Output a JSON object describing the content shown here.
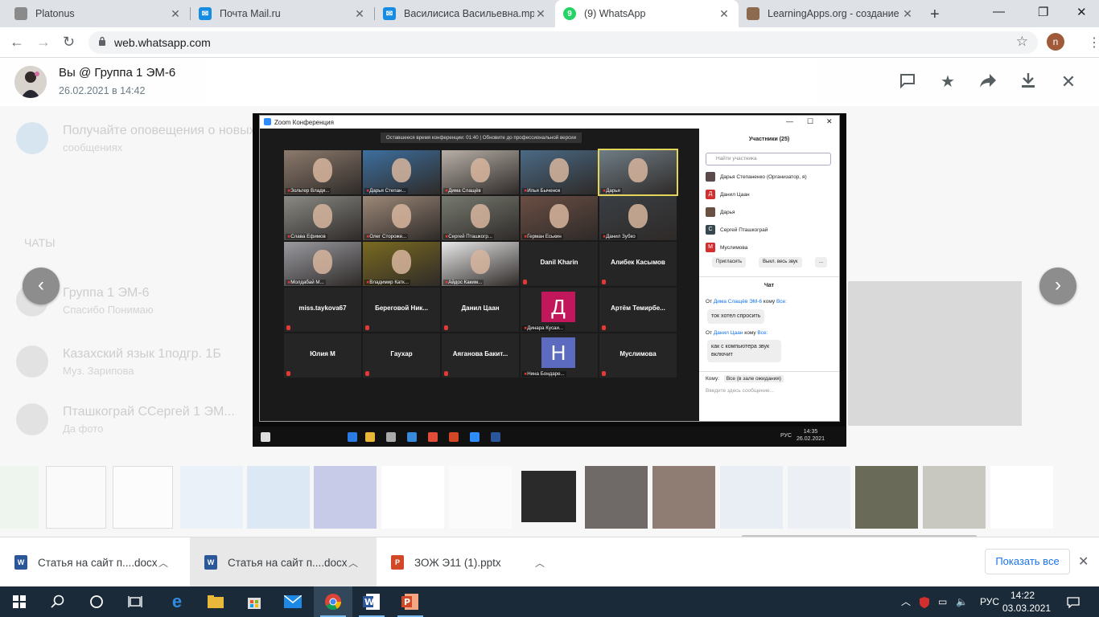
{
  "browser": {
    "tabs": [
      {
        "title": "Platonus",
        "color": "#8a8a8a"
      },
      {
        "title": "Почта Mail.ru",
        "color": "#168de2"
      },
      {
        "title": "Василисиса Васильевна.mp4",
        "color": "#168de2"
      },
      {
        "title": "(9) WhatsApp",
        "color": "#25d366",
        "badge": "9"
      },
      {
        "title": "LearningApps.org - создание",
        "color": "#8c6a4f"
      }
    ],
    "url": "web.whatsapp.com",
    "profile_initial": "n"
  },
  "viewer": {
    "sender": "Вы @ Группа 1 ЭМ-6",
    "timestamp": "26.02.2021 в 14:42",
    "bg_chats": [
      {
        "name": "Получайте оповещения о новых",
        "sub": "сообщениях"
      },
      {
        "name": "Группа 1 ЭМ-6",
        "sub": "Спасибо Понимаю"
      },
      {
        "name": "Казахский язык 1подгр. 1Б",
        "sub": "Муз. Зарипова"
      },
      {
        "name": "Пташкограй ССергей 1 ЭМ...",
        "sub": "Да фото"
      }
    ],
    "bg_label": "ЧАТЫ"
  },
  "zoom": {
    "window_title": "Zoom Конференция",
    "banner": "Оставшееся время конференции: 01:40 | Обновите до профессиональной версии",
    "tiles": [
      {
        "label": "Зольтер Влади...",
        "big": "",
        "color": "#8c7a6c"
      },
      {
        "label": "Дарья Степан...",
        "big": "",
        "color": "#3d6f9e"
      },
      {
        "label": "Дима Слащёв",
        "big": "",
        "color": "#b8b0a8"
      },
      {
        "label": "Илья Быченок",
        "big": "",
        "color": "#4a6a86"
      },
      {
        "label": "Дарья",
        "big": "",
        "color": "#6f7d86"
      },
      {
        "label": "Слава Ефимов",
        "big": "",
        "color": "#8a8a84"
      },
      {
        "label": "Олег Стороже...",
        "big": "",
        "color": "#9c8878"
      },
      {
        "label": "Сергей Пташкогр...",
        "big": "",
        "color": "#777a70"
      },
      {
        "label": "Герман Еськин",
        "big": "",
        "color": "#6a4e44"
      },
      {
        "label": "Данил Зубко",
        "big": "",
        "color": "#3a3f44"
      },
      {
        "label": "Молдабай М...",
        "big": "",
        "color": "#9a9aa0"
      },
      {
        "label": "Владимир Катк...",
        "big": "",
        "color": "#7a6a20"
      },
      {
        "label": "Айдос Каким...",
        "big": "",
        "color": "#e8e8e8"
      },
      {
        "label": "",
        "big": "Danil Kharin",
        "color": ""
      },
      {
        "label": "",
        "big": "Алибек Касымов",
        "color": ""
      },
      {
        "label": "",
        "big": "miss.taykova67",
        "color": ""
      },
      {
        "label": "",
        "big": "Береговой Ник...",
        "color": ""
      },
      {
        "label": "",
        "big": "Данил Цаан",
        "color": ""
      },
      {
        "label": "Динара Кусаи...",
        "big": "",
        "color": "letterД"
      },
      {
        "label": "",
        "big": "Артём Темирбе...",
        "color": ""
      },
      {
        "label": "",
        "big": "Юлия М",
        "color": ""
      },
      {
        "label": "",
        "big": "Гаухар",
        "color": ""
      },
      {
        "label": "",
        "big": "Аяганова Бакит...",
        "color": ""
      },
      {
        "label": "Нина Бондаре...",
        "big": "",
        "color": "letterН"
      },
      {
        "label": "",
        "big": "Муслимова",
        "color": ""
      }
    ],
    "participants_header": "Участники (25)",
    "search_placeholder": "Найти участника",
    "participants": [
      {
        "name": "Дарья Степаненко (Организатор, я)",
        "avatar": "#5a4a4a",
        "letter": ""
      },
      {
        "name": "Данил Цаан",
        "avatar": "#d32f2f",
        "letter": "Д"
      },
      {
        "name": "Дарья",
        "avatar": "#6a5040",
        "letter": ""
      },
      {
        "name": "Сергей Пташкограй",
        "avatar": "#37474f",
        "letter": "С"
      },
      {
        "name": "Муслимова",
        "avatar": "#d32f2f",
        "letter": "М"
      }
    ],
    "invite_label": "Пригласить",
    "mute_all_label": "Выкл. весь звук",
    "more_label": "...",
    "chat_header": "Чат",
    "chat": [
      {
        "from_prefix": "От",
        "from": "Дима Слащёв ЭМ-6",
        "to_prefix": "кому",
        "to": "Все:",
        "text": "ток хотел спросить"
      },
      {
        "from_prefix": "От",
        "from": "Данил Цаан",
        "to_prefix": "кому",
        "to": "Все:",
        "text": "как с компьютера звук включит"
      }
    ],
    "to_label": "Кому:",
    "to_value": "Все (в зале ожидания)",
    "chat_placeholder": "Введите здесь сообщение...",
    "tray_lang": "РУС",
    "tray_time": "14:35",
    "tray_date": "26.02.2021"
  },
  "downloads": [
    {
      "name": "Статья на сайт п....docx",
      "type": "W",
      "color": "#2b579a"
    },
    {
      "name": "Статья на сайт п....docx",
      "type": "W",
      "color": "#2b579a"
    },
    {
      "name": "ЗОЖ Э11 (1).pptx",
      "type": "P",
      "color": "#d24726"
    }
  ],
  "show_all": "Показать все",
  "taskbar": {
    "lang": "РУС",
    "time": "14:22",
    "date": "03.03.2021"
  }
}
